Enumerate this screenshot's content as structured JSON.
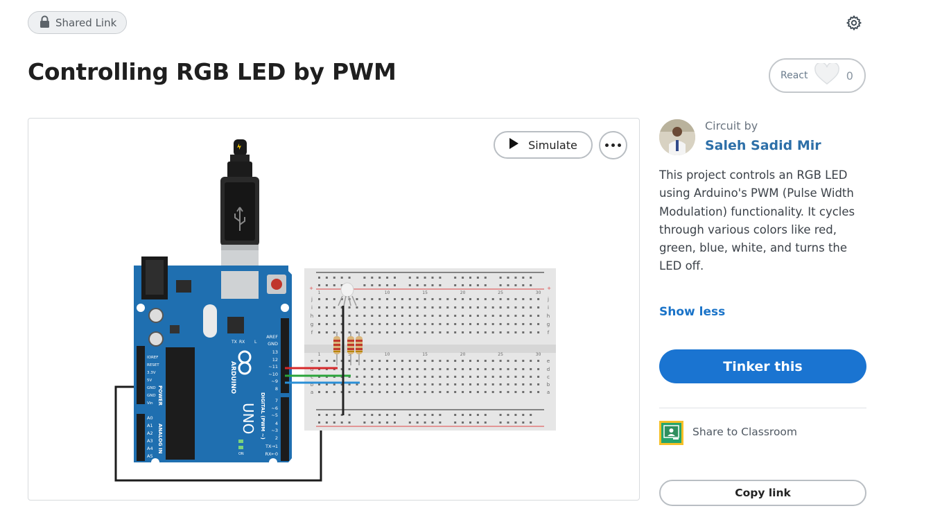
{
  "header": {
    "shared_link_label": "Shared Link",
    "title": "Controlling RGB LED by PWM",
    "react_label": "React",
    "react_count": "0"
  },
  "canvas": {
    "simulate_label": "Simulate",
    "board": {
      "name": "ARDUINO",
      "model": "UNO",
      "digital_label": "DIGITAL (PWM ~)",
      "power_label": "POWER",
      "analog_label": "ANALOG IN",
      "digital_pins": [
        "AREF",
        "GND",
        "13",
        "12",
        "~11",
        "~10",
        "~9",
        "8",
        "7",
        "~6",
        "~5",
        "4",
        "~3",
        "2",
        "TX→1",
        "RX←0"
      ],
      "power_pins": [
        "IOREF",
        "RESET",
        "3.3V",
        "5V",
        "GND",
        "GND",
        "Vin"
      ],
      "analog_pins": [
        "A0",
        "A1",
        "A2",
        "A3",
        "A4",
        "A5"
      ],
      "tx_label": "TX",
      "rx_label": "RX",
      "l_label": "L",
      "on_label": "ON"
    },
    "breadboard": {
      "row_labels_top": [
        "j",
        "i",
        "h",
        "g",
        "f"
      ],
      "row_labels_bottom": [
        "e",
        "d",
        "c",
        "b",
        "a"
      ],
      "column_numbers": [
        "1",
        "5",
        "10",
        "15",
        "20",
        "25",
        "30"
      ]
    },
    "wire_colors": {
      "red": "#d6282a",
      "green": "#2aa43a",
      "blue": "#2a8fd6",
      "black": "#222222"
    }
  },
  "sidebar": {
    "circuit_by_label": "Circuit by",
    "author": "Saleh Sadid Mir",
    "description": "This project controls an RGB LED using Arduino's PWM (Pulse Width Modulation) functionality. It cycles through various colors like red, green, blue, white, and turns the LED off.",
    "show_less_label": "Show less",
    "tinker_label": "Tinker this",
    "share_classroom_label": "Share to Classroom",
    "copy_link_label": "Copy link"
  },
  "icons": {
    "lock": "lock-icon",
    "gear": "gear-icon",
    "heart": "heart-icon",
    "play": "play-icon",
    "more": "more-icon",
    "classroom": "google-classroom-icon"
  },
  "colors": {
    "accent": "#1a74d1",
    "author_link": "#2d6fa8",
    "arduino_blue": "#1f6fb0"
  }
}
